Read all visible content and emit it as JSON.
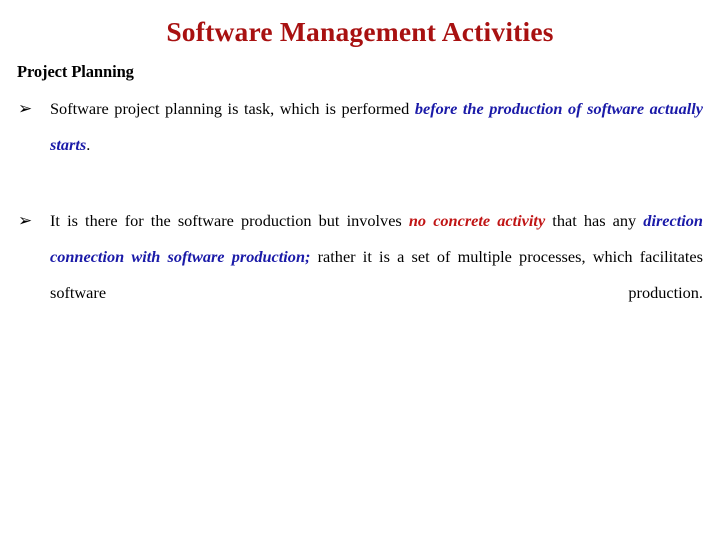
{
  "slide": {
    "title": "Software Management Activities",
    "title_color": "#a81111",
    "background_color": "#ffffff",
    "section_heading": "Project Planning",
    "bullet_marker_glyph": "➢",
    "emphasis_colors": {
      "blue": "#1a1aa8",
      "red": "#c01515",
      "plain": "#000000"
    },
    "bullets": [
      {
        "marker": "➢",
        "runs": [
          {
            "text": "Software project planning is task, which is performed ",
            "style": "plain"
          },
          {
            "text": "before the production of software actually starts",
            "style": "em-blue"
          },
          {
            "text": ".",
            "style": "plain"
          }
        ]
      },
      {
        "marker": "➢",
        "runs": [
          {
            "text": "It is there for the software production but involves ",
            "style": "plain"
          },
          {
            "text": "no concrete activity",
            "style": "em-red"
          },
          {
            "text": " that has any ",
            "style": "plain"
          },
          {
            "text": "direction connection with software production;",
            "style": "em-blue"
          },
          {
            "text": " rather it is a set of multiple processes, which facilitates software production.",
            "style": "plain"
          }
        ]
      }
    ]
  }
}
